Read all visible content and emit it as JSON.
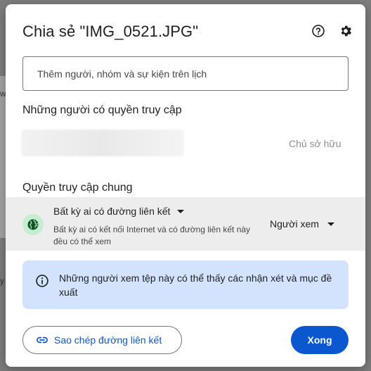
{
  "dialog": {
    "title": "Chia sẻ \"IMG_0521.JPG\"",
    "help_icon": "help-circle-icon",
    "settings_icon": "gear-icon"
  },
  "add_people": {
    "placeholder": "Thêm người, nhóm và sự kiện trên lịch"
  },
  "people_with_access": {
    "title": "Những người có quyền truy cập",
    "owner_role": "Chủ sở hữu"
  },
  "general_access": {
    "title": "Quyền truy cập chung",
    "icon": "globe-icon",
    "selected_option": "Bất kỳ ai có đường liên kết",
    "description": "Bất kỳ ai có kết nối Internet và có đường liên kết này đều có thể xem",
    "role": "Người xem"
  },
  "info_banner": {
    "icon": "info-icon",
    "text": "Những người xem tệp này có thể thấy các nhận xét và mục đề xuất"
  },
  "footer": {
    "copy_link_label": "Sao chép đường liên kết",
    "copy_link_icon": "link-icon",
    "done_label": "Xong"
  },
  "colors": {
    "primary": "#0b57d0",
    "info_bg": "#d3e3fd",
    "globe_bg": "#c4eed0"
  }
}
